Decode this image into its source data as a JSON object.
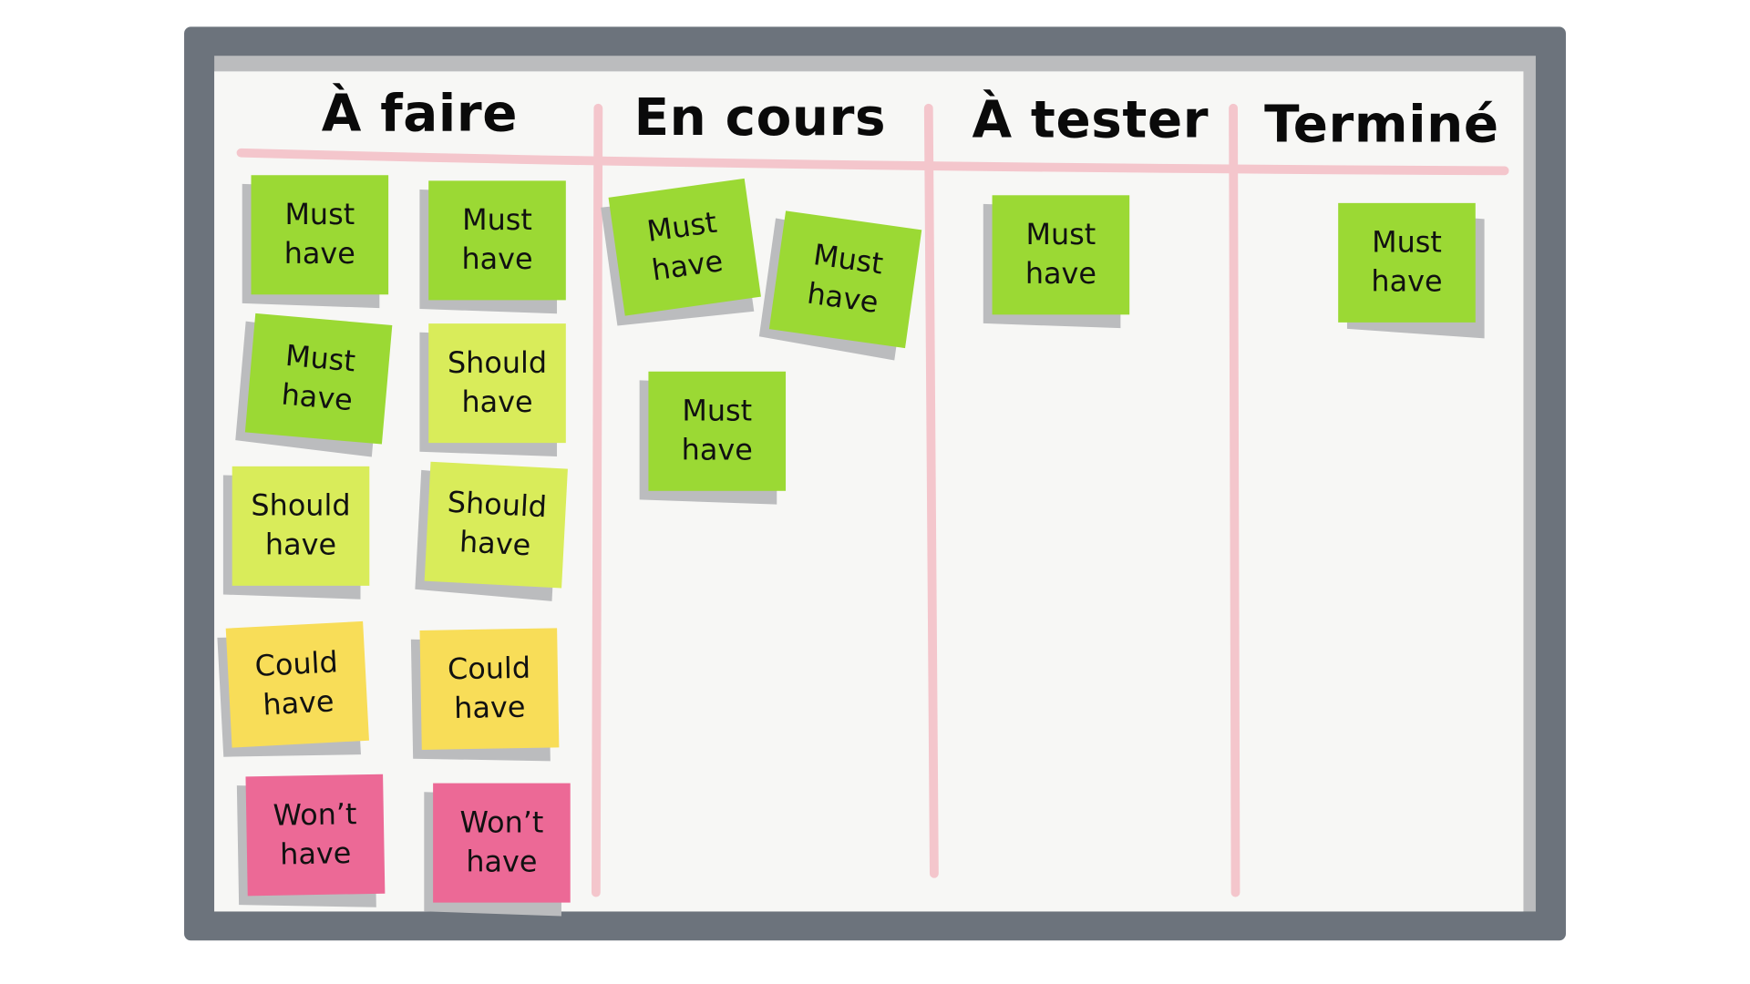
{
  "board": {
    "columns": [
      {
        "title": "À faire",
        "notes": [
          {
            "line1": "Must",
            "line2": "have",
            "priority": "must"
          },
          {
            "line1": "Must",
            "line2": "have",
            "priority": "must"
          },
          {
            "line1": "Must",
            "line2": "have",
            "priority": "must"
          },
          {
            "line1": "Should",
            "line2": "have",
            "priority": "should"
          },
          {
            "line1": "Should",
            "line2": "have",
            "priority": "should"
          },
          {
            "line1": "Should",
            "line2": "have",
            "priority": "should"
          },
          {
            "line1": "Could",
            "line2": "have",
            "priority": "could"
          },
          {
            "line1": "Could",
            "line2": "have",
            "priority": "could"
          },
          {
            "line1": "Won’t",
            "line2": "have",
            "priority": "wont"
          },
          {
            "line1": "Won’t",
            "line2": "have",
            "priority": "wont"
          }
        ]
      },
      {
        "title": "En cours",
        "notes": [
          {
            "line1": "Must",
            "line2": "have",
            "priority": "must"
          },
          {
            "line1": "Must",
            "line2": "have",
            "priority": "must"
          },
          {
            "line1": "Must",
            "line2": "have",
            "priority": "must"
          }
        ]
      },
      {
        "title": "À tester",
        "notes": [
          {
            "line1": "Must",
            "line2": "have",
            "priority": "must"
          }
        ]
      },
      {
        "title": "Terminé",
        "notes": [
          {
            "line1": "Must",
            "line2": "have",
            "priority": "must"
          }
        ]
      }
    ]
  },
  "colors": {
    "frame": "#6c737c",
    "surface": "#f7f7f5",
    "divider": "#f4c6cc",
    "must": "#9bd934",
    "should": "#d9ec5a",
    "could": "#f8dd58",
    "wont": "#ec6996"
  }
}
